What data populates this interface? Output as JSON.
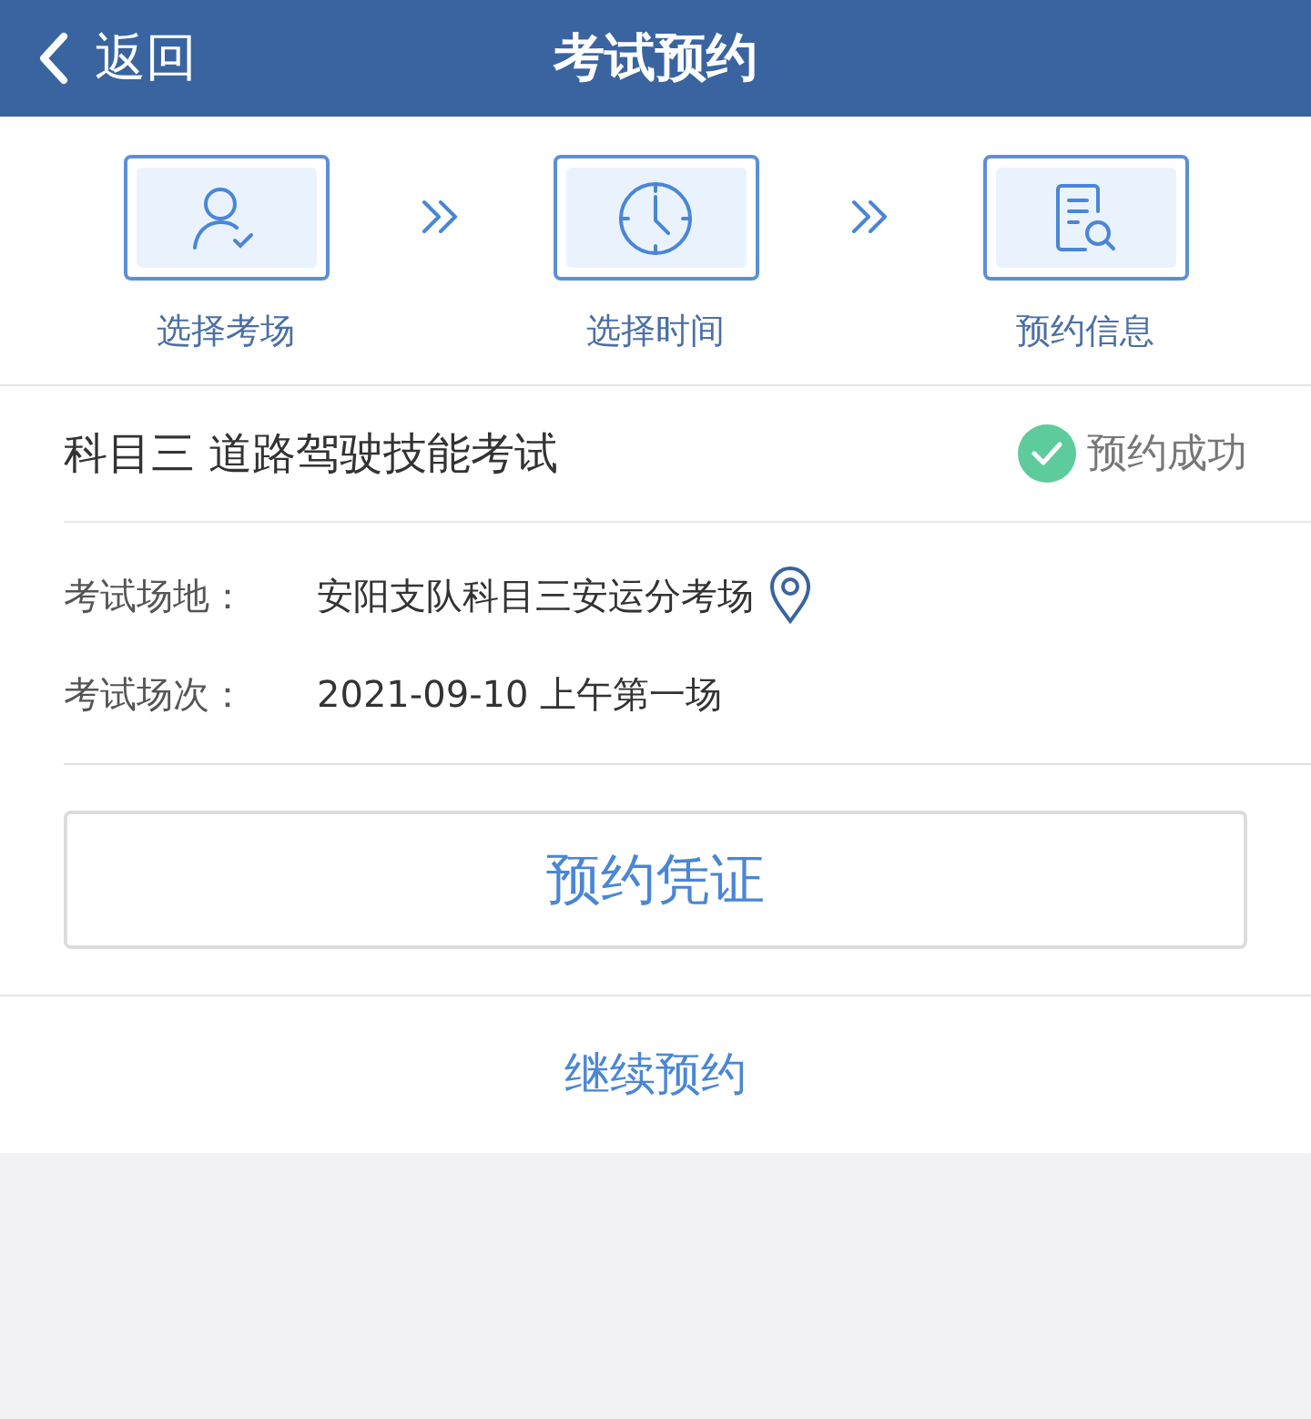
{
  "header": {
    "back": "返回",
    "title": "考试预约"
  },
  "steps": [
    {
      "kind": "person",
      "label": "选择考场"
    },
    {
      "kind": "clock",
      "label": "选择时间"
    },
    {
      "kind": "document",
      "label": "预约信息"
    }
  ],
  "exam": {
    "title": "科目三 道路驾驶技能考试",
    "status": {
      "kind": "success",
      "text": "预约成功"
    }
  },
  "details": [
    {
      "label": "考试场地：",
      "value": "安阳支队科目三安运分考场",
      "kind": "location"
    },
    {
      "label": "考试场次：",
      "value": "2021-09-10 上午第一场",
      "kind": "text"
    }
  ],
  "voucher_button": "预约凭证",
  "continue_link": "继续预约"
}
